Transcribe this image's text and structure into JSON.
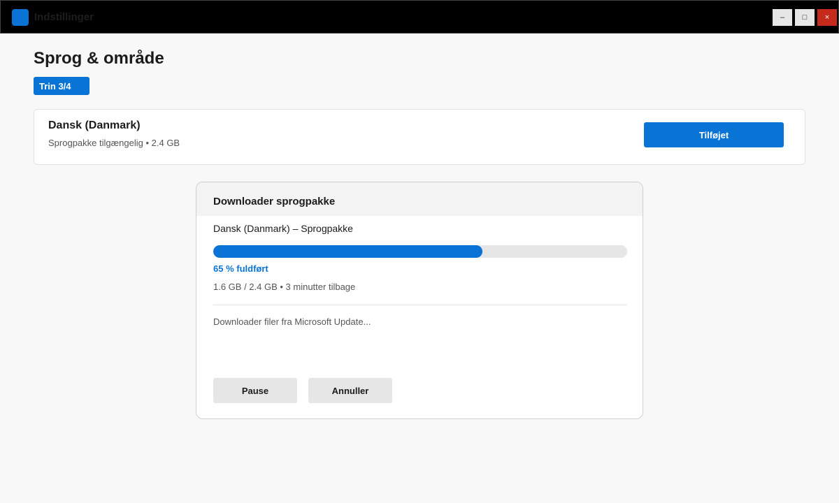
{
  "window": {
    "title": "Indstillinger",
    "controls": {
      "minimize": "–",
      "maximize": "□",
      "close": "×"
    }
  },
  "page": {
    "title": "Sprog & område",
    "step_badge": "Trin 3/4"
  },
  "language_card": {
    "name": "Dansk (Danmark)",
    "info": "Sprogpakke tilgængelig • 2.4 GB",
    "button_label": "Tilføjet"
  },
  "download_dialog": {
    "title": "Downloader sprogpakke",
    "package_name": "Dansk (Danmark) – Sprogpakke",
    "progress_percent": 65,
    "progress_label": "65 % fuldført",
    "progress_detail": "1.6 GB / 2.4 GB • 3 minutter tilbage",
    "status_text": "Downloader filer fra Microsoft Update...",
    "pause_label": "Pause",
    "cancel_label": "Annuller"
  },
  "colors": {
    "accent": "#0a74d6",
    "close_button": "#c42b1c",
    "titlebar": "#000000",
    "background": "#f8f8f8"
  },
  "icons": {
    "app_icon": "settings-app-icon"
  }
}
